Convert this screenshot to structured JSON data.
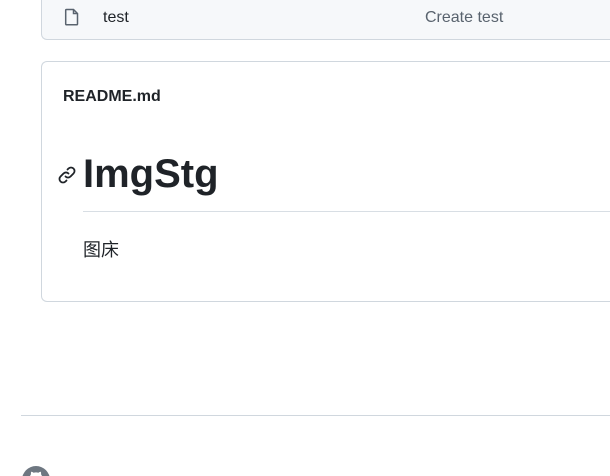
{
  "file_list": {
    "rows": [
      {
        "icon": "file-icon",
        "name": "test",
        "commit_message": "Create test"
      }
    ]
  },
  "readme": {
    "filename": "README.md",
    "heading": "ImgStg",
    "anchor_icon": "link-icon",
    "paragraph": "图床"
  },
  "footer": {
    "logo_icon": "github-logo-icon"
  },
  "colors": {
    "border": "#d0d7de",
    "text": "#1f2328",
    "muted": "#59636e",
    "row_bg": "#f6f8fa"
  }
}
